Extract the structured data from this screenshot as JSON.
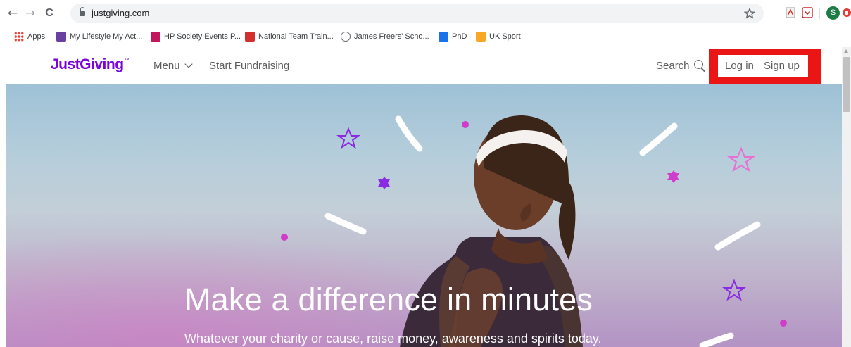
{
  "browser": {
    "url": "justgiving.com",
    "nav": {
      "back": "←",
      "forward": "→",
      "reload": "C"
    },
    "profile_initial": "S",
    "bookmarks": [
      {
        "label": "Apps",
        "icon": "apps-grid-icon",
        "color": "#e8453c"
      },
      {
        "label": "My Lifestyle My Act...",
        "icon": "bookmark-favicon",
        "color": "#6b3fa0"
      },
      {
        "label": "HP Society Events P...",
        "icon": "bookmark-favicon",
        "color": "#c2185b"
      },
      {
        "label": "National Team Train...",
        "icon": "bookmark-favicon",
        "color": "#d32f2f"
      },
      {
        "label": "James Freers' Scho...",
        "icon": "globe-icon",
        "color": "#5f6368"
      },
      {
        "label": "PhD",
        "icon": "bookmark-favicon",
        "color": "#1a73e8"
      },
      {
        "label": "UK Sport",
        "icon": "bookmark-favicon",
        "color": "#f9a825"
      }
    ]
  },
  "site": {
    "logo": "JustGiving",
    "logo_mark": "™",
    "nav": {
      "menu_label": "Menu",
      "start_label": "Start Fundraising",
      "search_label": "Search"
    },
    "auth": {
      "login_label": "Log in",
      "signup_label": "Sign up",
      "highlight_color": "#ea1616"
    },
    "brand_color": "#7a04dd"
  },
  "hero": {
    "headline": "Make a difference in minutes",
    "subheadline": "Whatever your charity or cause, raise money, awareness and spirits today."
  }
}
